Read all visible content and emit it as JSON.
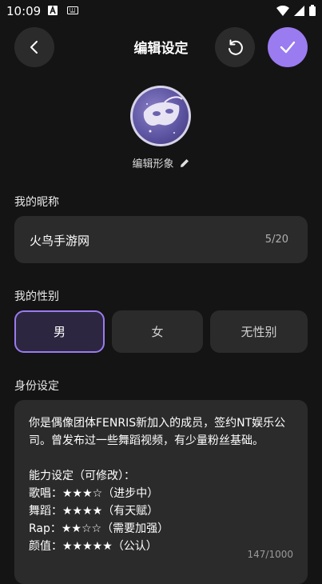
{
  "status": {
    "time": "10:09"
  },
  "header": {
    "title": "编辑设定"
  },
  "avatar": {
    "edit_label": "编辑形象"
  },
  "nickname": {
    "section_label": "我的昵称",
    "value": "火鸟手游网",
    "counter": "5/20"
  },
  "gender": {
    "section_label": "我的性别",
    "options": [
      "男",
      "女",
      "无性别"
    ],
    "selected": "男"
  },
  "persona": {
    "section_label": "身份设定",
    "text": "你是偶像团体FENRIS新加入的成员，签约NT娱乐公司。曾发布过一些舞蹈视频，有少量粉丝基础。\n\n能力设定（可修改）：\n歌唱：★★★☆（进步中）\n舞蹈：★★★★（有天赋）\nRap：★★☆☆（需要加强）\n颜值：★★★★★（公认）",
    "counter": "147/1000"
  },
  "colors": {
    "accent": "#9a7bf0",
    "background": "#141414",
    "surface": "#2b2b2b"
  }
}
